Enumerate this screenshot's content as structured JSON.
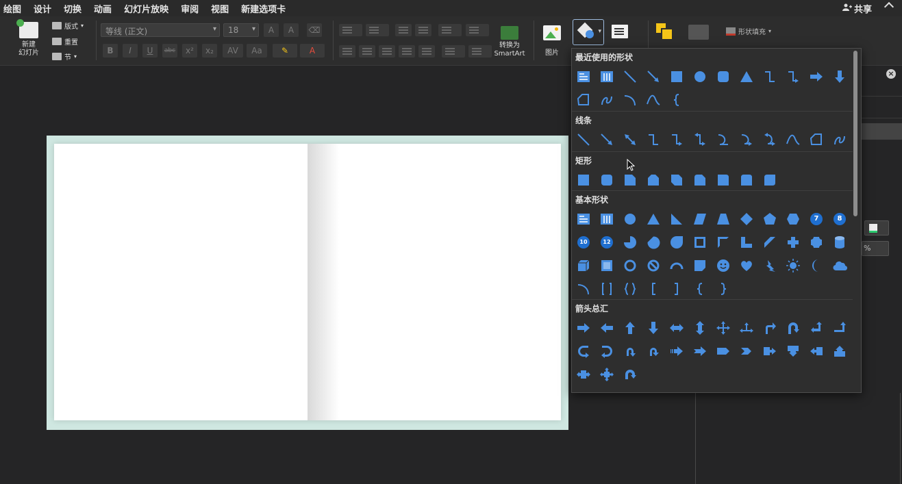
{
  "menu": {
    "tabs": [
      "绘图",
      "设计",
      "切换",
      "动画",
      "幻灯片放映",
      "审阅",
      "视图",
      "新建选项卡"
    ],
    "share_label": "共享"
  },
  "ribbon": {
    "new_slide_label": "新建\n幻灯片",
    "layout_label": "版式",
    "reset_label": "重置",
    "section_label": "节",
    "font_name": "等线 (正文)",
    "font_size": "18",
    "smartart_label": "转换为\nSmartArt",
    "picture_label": "图片",
    "shape_fill_label": "形状填充"
  },
  "gallery": {
    "sections": [
      {
        "title": "最近使用的形状",
        "rows": [
          [
            "textbox",
            "vtextbox",
            "line",
            "arrow-line",
            "rect",
            "circle",
            "rounded-rect",
            "triangle",
            "elbow",
            "elbow-arrow",
            "right-arrow",
            "down-arrow"
          ],
          [
            "freeform",
            "scribble",
            "arc",
            "curve",
            "left-brace"
          ]
        ]
      },
      {
        "title": "线条",
        "rows": [
          [
            "line",
            "arrow-line",
            "double-arrow-line",
            "elbow",
            "elbow-arrow",
            "elbow-double-arrow",
            "curved-connector",
            "curved-arrow",
            "curved-double-arrow",
            "curve",
            "freeform",
            "scribble"
          ]
        ]
      },
      {
        "title": "矩形",
        "rows": [
          [
            "rect",
            "rounded-rect",
            "snip-corner",
            "snip-same",
            "snip-diag",
            "snip-round",
            "round-one",
            "round-same",
            "round-diag"
          ]
        ]
      },
      {
        "title": "基本形状",
        "rows": [
          [
            "textbox",
            "vtextbox",
            "oval",
            "triangle",
            "right-triangle",
            "parallelogram",
            "trapezoid",
            "diamond",
            "pentagon",
            "hexagon",
            "heptagon-7",
            "octagon-8"
          ],
          [
            "decagon-10",
            "dodecagon-12",
            "pie",
            "chord",
            "teardrop",
            "frame",
            "half-frame",
            "l-shape",
            "diagonal-stripe",
            "cross",
            "plaque",
            "can"
          ],
          [
            "cube",
            "bevel",
            "donut",
            "no-symbol",
            "block-arc",
            "folded-corner",
            "smiley",
            "heart",
            "lightning",
            "sun",
            "moon",
            "cloud"
          ],
          [
            "arc",
            "bracket-pair",
            "brace-pair",
            "left-bracket",
            "right-bracket",
            "left-brace",
            "right-brace"
          ]
        ]
      },
      {
        "title": "箭头总汇",
        "rows": [
          [
            "right-arrow",
            "left-arrow",
            "up-arrow",
            "down-arrow",
            "left-right-arrow",
            "up-down-arrow",
            "quad-arrow",
            "left-right-up-arrow",
            "bent-arrow",
            "u-turn-arrow",
            "left-up-arrow",
            "bent-up-arrow"
          ],
          [
            "curved-right-arrow",
            "curved-left-arrow",
            "curved-up-arrow",
            "curved-down-arrow",
            "striped-right-arrow",
            "notched-right-arrow",
            "pentagon-arrow",
            "chevron",
            "right-arrow-callout",
            "down-arrow-callout",
            "left-arrow-callout",
            "up-arrow-callout"
          ],
          [
            "left-right-arrow-callout",
            "quad-arrow-callout",
            "circular-arrow"
          ]
        ]
      }
    ],
    "number_badges": {
      "heptagon-7": "7",
      "octagon-8": "8",
      "decagon-10": "10",
      "dodecagon-12": "12"
    }
  },
  "pane": {
    "close_label": "×",
    "percent_suffix": "%"
  },
  "colors": {
    "shape_blue": "#4a90e2",
    "panel_bg": "#2e2e2e",
    "slide_border": "#cfe7e1"
  }
}
